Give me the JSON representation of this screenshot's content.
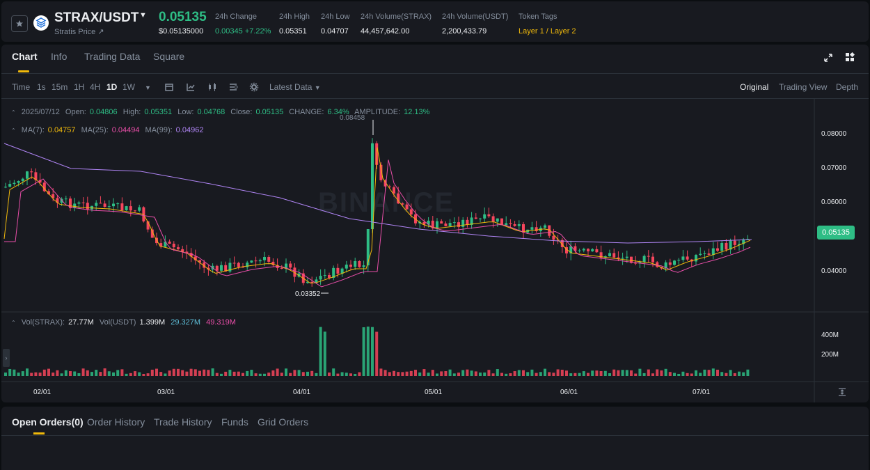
{
  "header": {
    "pair": "STRAX/USDT",
    "sub_link": "Stratis Price ↗",
    "last_price": "0.05135",
    "last_price_usd": "$0.05135000",
    "stats": [
      {
        "label": "24h Change",
        "value": "0.00345 +7.22%"
      },
      {
        "label": "24h High",
        "value": "0.05351"
      },
      {
        "label": "24h Low",
        "value": "0.04707"
      },
      {
        "label": "24h Volume(STRAX)",
        "value": "44,457,642.00"
      },
      {
        "label": "24h Volume(USDT)",
        "value": "2,200,433.79"
      },
      {
        "label": "Token Tags",
        "value": "Layer 1 / Layer 2"
      }
    ]
  },
  "tabs": [
    "Chart",
    "Info",
    "Trading Data",
    "Square"
  ],
  "toolbar": {
    "time_label": "Time",
    "intervals": [
      "1s",
      "15m",
      "1H",
      "4H",
      "1D",
      "1W"
    ],
    "active_interval": "1D",
    "latest_data": "Latest Data",
    "views": [
      "Original",
      "Trading View",
      "Depth"
    ],
    "active_view": "Original"
  },
  "ohlc_legend": {
    "date": "2025/07/12",
    "open_label": "Open:",
    "open": "0.04806",
    "high_label": "High:",
    "high": "0.05351",
    "low_label": "Low:",
    "low": "0.04768",
    "close_label": "Close:",
    "close": "0.05135",
    "change_label": "CHANGE:",
    "change": "6.34%",
    "amplitude_label": "AMPLITUDE:",
    "amplitude": "12.13%"
  },
  "ma_legend": {
    "ma7_label": "MA(7):",
    "ma7": "0.04757",
    "ma25_label": "MA(25):",
    "ma25": "0.04494",
    "ma99_label": "MA(99):",
    "ma99": "0.04962"
  },
  "vol_legend": {
    "strax_label": "Vol(STRAX):",
    "strax": "27.77M",
    "usdt_label": "Vol(USDT)",
    "usdt": "1.399M",
    "v1": "29.327M",
    "v2": "49.319M"
  },
  "price_axis": [
    "0.08000",
    "0.07000",
    "0.06000",
    "0.04000"
  ],
  "volume_axis": [
    "400M",
    "200M"
  ],
  "date_axis": [
    "02/01",
    "03/01",
    "04/01",
    "05/01",
    "06/01",
    "07/01"
  ],
  "current_price_tag": "0.05135",
  "high_marker": "0.08458",
  "low_marker": "0.03352",
  "watermark": "BINANCE",
  "orders_tabs": [
    "Open Orders(0)",
    "Order History",
    "Trade History",
    "Funds",
    "Grid Orders"
  ],
  "colors": {
    "up": "#2ebd85",
    "down": "#f6465d",
    "ma7": "#f0b90b",
    "ma25": "#e84ea8",
    "ma99": "#b085f5",
    "accent": "#f0b90b"
  }
}
